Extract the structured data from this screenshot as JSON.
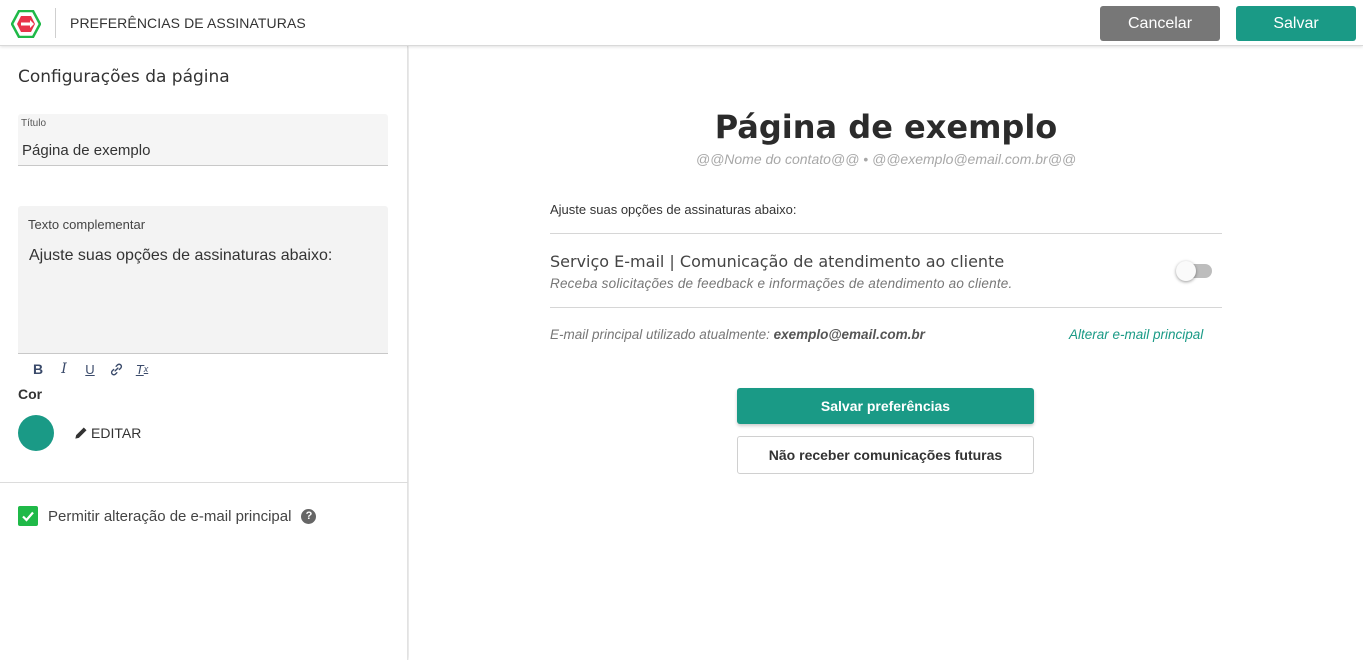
{
  "header": {
    "title": "PREFERÊNCIAS DE ASSINATURAS",
    "cancel_label": "Cancelar",
    "save_label": "Salvar",
    "logo_icon": "brand-logo-icon"
  },
  "sidebar": {
    "heading": "Configurações da página",
    "title_field": {
      "label": "Título",
      "value": "Página de exemplo"
    },
    "text_field": {
      "label": "Texto complementar",
      "value": "Ajuste suas opções de assinaturas abaixo:"
    },
    "toolbar": [
      {
        "name": "bold-icon",
        "glyph": "B"
      },
      {
        "name": "italic-icon",
        "glyph": "I"
      },
      {
        "name": "underline-icon",
        "glyph": "U"
      },
      {
        "name": "link-icon",
        "glyph": "link"
      },
      {
        "name": "clear-format-icon",
        "glyph": "Tx"
      }
    ],
    "color_label": "Cor",
    "color_value": "#1a9a86",
    "edit_label": "EDITAR",
    "checkbox_label": "Permitir alteração de e-mail principal",
    "checkbox_checked": true
  },
  "preview": {
    "title": "Página de exemplo",
    "subtitle": "@@Nome do contato@@ • @@exemplo@email.com.br@@",
    "intro": "Ajuste suas opções de assinaturas abaixo:",
    "service": {
      "title": "Serviço E-mail | Comunicação de atendimento ao cliente",
      "description": "Receba solicitações de feedback e informações de atendimento ao cliente.",
      "enabled": false
    },
    "email_prefix": "E-mail principal utilizado atualmente: ",
    "email_value": "exemplo@email.com.br",
    "change_email_label": "Alterar e-mail principal",
    "save_prefs_label": "Salvar preferências",
    "unsubscribe_label": "Não receber comunicações futuras"
  },
  "colors": {
    "accent": "#1a9a86",
    "cancel": "#777777",
    "checkbox": "#1fb948"
  }
}
